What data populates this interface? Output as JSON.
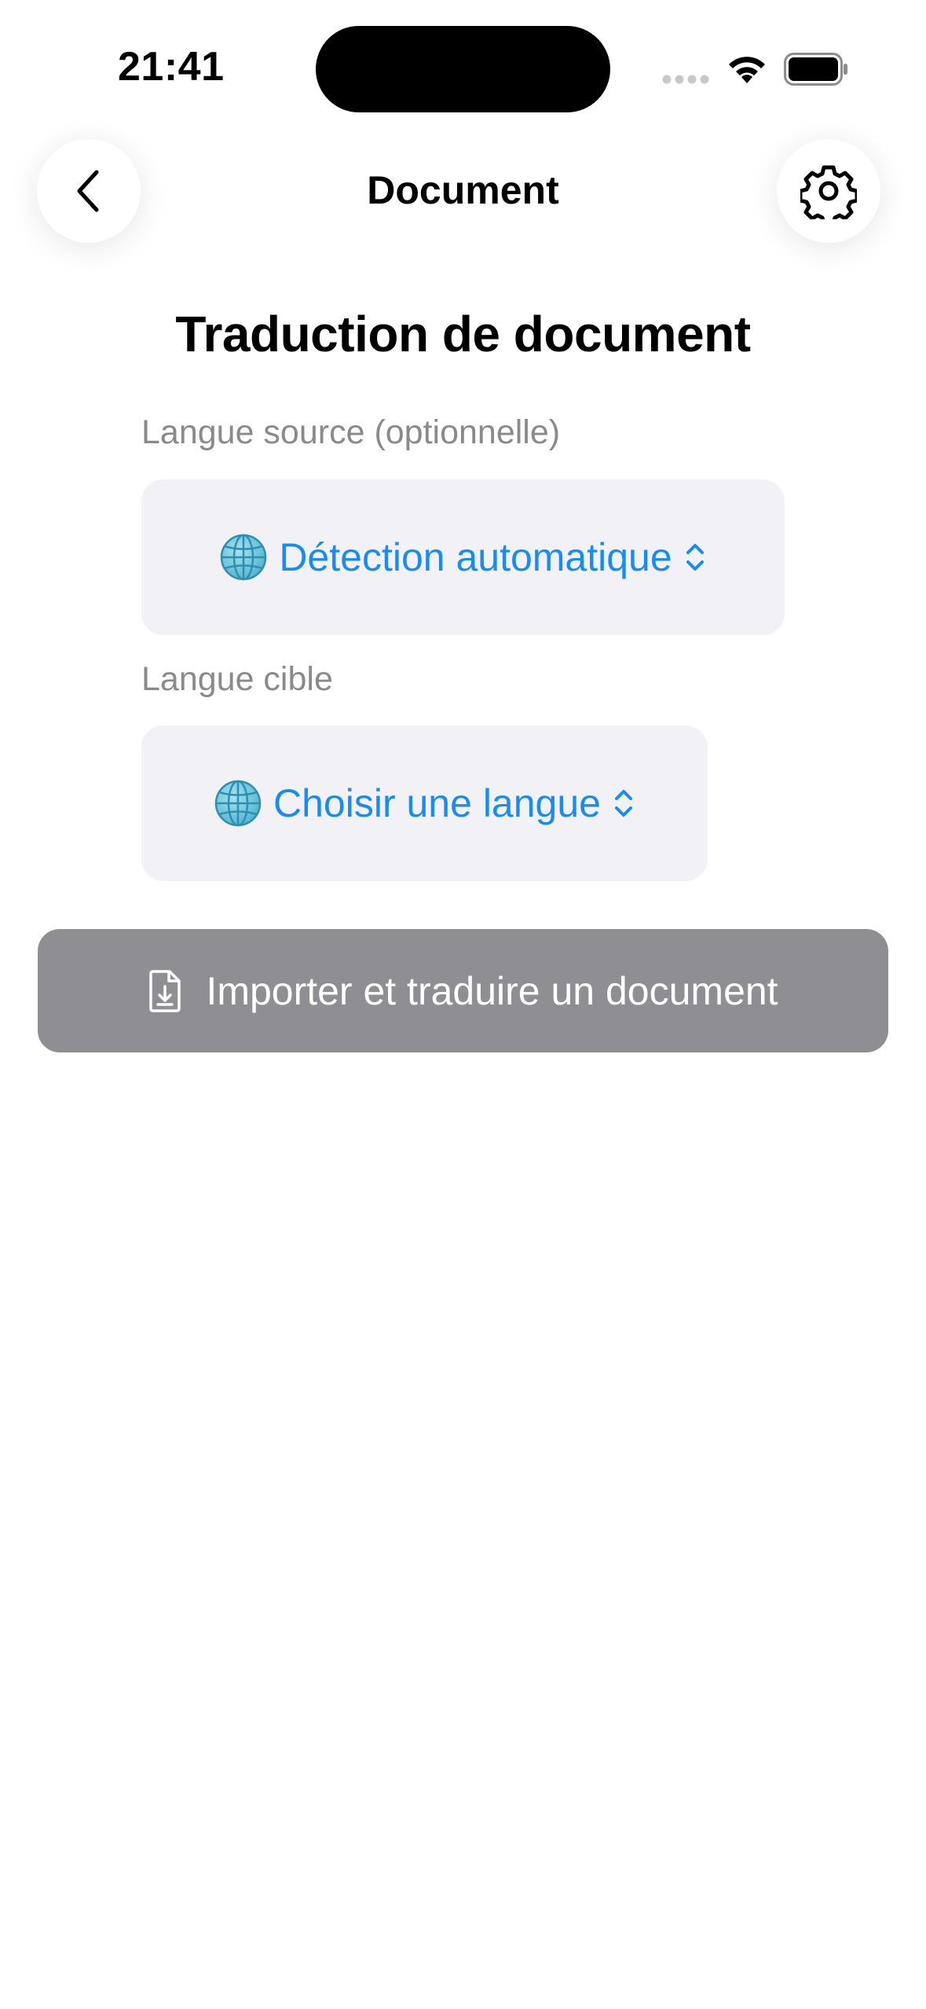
{
  "status_bar": {
    "time": "21:41"
  },
  "nav": {
    "title": "Document"
  },
  "page": {
    "heading": "Traduction de document"
  },
  "source": {
    "label": "Langue source (optionnelle)",
    "value": "Détection automatique"
  },
  "target": {
    "label": "Langue cible",
    "value": "Choisir une langue"
  },
  "action": {
    "import_label": "Importer et traduire un document"
  },
  "colors": {
    "accent": "#1a8cf0",
    "picker_bg": "#f1f1f6",
    "disabled_button": "#8e8e93",
    "secondary_text": "#8a8a8e"
  },
  "icons": [
    "chevron-left-icon",
    "gear-icon",
    "globe-icon",
    "up-down-chevron-icon",
    "document-import-icon",
    "wifi-icon",
    "battery-icon",
    "cellular-icon"
  ]
}
